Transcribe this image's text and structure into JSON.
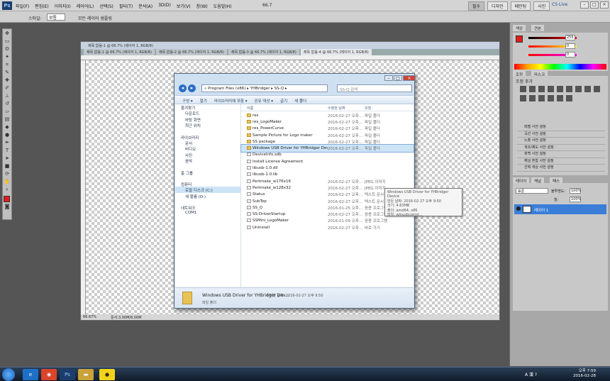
{
  "photoshop": {
    "logo": "Ps",
    "menus": [
      "파일(F)",
      "편집(E)",
      "이미지(I)",
      "레이어(L)",
      "선택(S)",
      "필터(T)",
      "분석(A)",
      "3D(D)",
      "보기(V)",
      "창(W)",
      "도움말(H)"
    ],
    "zoom": "66.7",
    "workspaces": [
      "필수",
      "디자인",
      "페인팅",
      "사진"
    ],
    "cslive": "CS Live",
    "options": {
      "label": "스타일:",
      "value": "보통",
      "label2": "모든 레이어 샘플링"
    }
  },
  "document": {
    "title": "제목 없음-1 @ 66.7% (레이어 1, RGB/8)",
    "tabs": [
      "제목 없음-1 @ 66.7% (레이어 1, RGB/8)",
      "제목 없음-2 @ 66.7% (레이어 1, RGB/8)",
      "제목 없음-3 @ 66.7% (레이어 1, RGB/8)",
      "제목 없음-4 @ 66.7% (레이어 1, RGB/8)"
    ],
    "zoom_status": "66.67%",
    "doc_status": "문서:3.00M/6.00M"
  },
  "explorer": {
    "path": "« Program Files (x86) ▸ YHBridger ▸ SS-Q ▸",
    "search_placeholder": "SS-Q 검색",
    "commands": [
      "구성 ▾",
      "열기",
      "라이브러리에 포함 ▾",
      "공유 대상 ▾",
      "굽기",
      "새 폴더"
    ],
    "nav": [
      {
        "label": "즐겨찾기",
        "sub": false
      },
      {
        "label": "다운로드",
        "sub": true
      },
      {
        "label": "바탕 화면",
        "sub": true
      },
      {
        "label": "최근 위치",
        "sub": true
      },
      {
        "label": "",
        "sub": false
      },
      {
        "label": "라이브러리",
        "sub": false
      },
      {
        "label": "문서",
        "sub": true
      },
      {
        "label": "비디오",
        "sub": true
      },
      {
        "label": "사진",
        "sub": true
      },
      {
        "label": "음악",
        "sub": true
      },
      {
        "label": "",
        "sub": false
      },
      {
        "label": "홈 그룹",
        "sub": false
      },
      {
        "label": "",
        "sub": false
      },
      {
        "label": "컴퓨터",
        "sub": false
      },
      {
        "label": "로컬 디스크 (C:)",
        "sub": true,
        "selected": true
      },
      {
        "label": "새 볼륨 (D:)",
        "sub": true
      },
      {
        "label": "",
        "sub": false
      },
      {
        "label": "네트워크",
        "sub": false
      },
      {
        "label": "COM1",
        "sub": true
      }
    ],
    "columns": [
      "이름",
      "수정한 날짜",
      "유형"
    ],
    "files": [
      {
        "name": "res",
        "date": "2016-02-27 오후...",
        "type": "파일 폴더",
        "icon": "folder-icon"
      },
      {
        "name": "res_LogoMaker",
        "date": "2016-02-27 오후...",
        "type": "파일 폴더",
        "icon": "folder-icon"
      },
      {
        "name": "res_PowerCurve",
        "date": "2016-02-27 오후...",
        "type": "파일 폴더",
        "icon": "folder-icon"
      },
      {
        "name": "Sample Picture for Logo maker",
        "date": "2016-02-27 오후...",
        "type": "파일 폴더",
        "icon": "folder-icon"
      },
      {
        "name": "SS package",
        "date": "2016-02-27 오후...",
        "type": "파일 폴더",
        "icon": "folder-icon"
      },
      {
        "name": "Windows USB Driver for YHBridger Dev...",
        "date": "2016-02-27 오후...",
        "type": "파일 폴더",
        "icon": "folder-icon",
        "selected": true
      },
      {
        "name": "DeviceInfo.sdb",
        "date": "",
        "type": "",
        "icon": "file-icon"
      },
      {
        "name": "Install License Agreement",
        "date": "",
        "type": "",
        "icon": "file-icon"
      },
      {
        "name": "libusb-1.0.dll",
        "date": "",
        "type": "",
        "icon": "file-icon"
      },
      {
        "name": "libusb-1.0.lib",
        "date": "",
        "type": "",
        "icon": "file-icon"
      },
      {
        "name": "Pertmake_w176x16",
        "date": "2016-02-27 오후...",
        "type": "JPEG 이미지",
        "icon": "file-icon"
      },
      {
        "name": "Pertmake_w128x32",
        "date": "2016-02-27 오후...",
        "type": "JPEG 이미지",
        "icon": "file-icon"
      },
      {
        "name": "Status",
        "date": "2016-02-27 오후...",
        "type": "텍스트 문서",
        "icon": "file-icon"
      },
      {
        "name": "SubTop",
        "date": "2016-02-27 오후...",
        "type": "텍스트 문서",
        "icon": "file-icon"
      },
      {
        "name": "SS_Q",
        "date": "2016-01-25 오후...",
        "type": "응용 프로그램",
        "icon": "file-icon"
      },
      {
        "name": "SS-DriverStartup",
        "date": "2016-02-27 오후...",
        "type": "응용 프로그램",
        "icon": "file-icon"
      },
      {
        "name": "SSMini_LogoMaker",
        "date": "2016-01-09 오후...",
        "type": "응용 프로그램",
        "icon": "file-icon"
      },
      {
        "name": "Uninstall",
        "date": "2016-02-27 오후...",
        "type": "바로 가기",
        "icon": "file-icon"
      }
    ],
    "tooltip": [
      "Windows USB Driver for YHBridger Device",
      "만든 날짜: 2016-02-27 오후 9:50",
      "크기: 4.63MB",
      "폴더: amd64, x86",
      "파일: winusbcoinst..."
    ],
    "details": {
      "name": "Windows USB Driver for YHBridger Dev...",
      "meta": "수정한 날짜: 2016-02-27 오후 9:50",
      "type": "파일 폴더"
    }
  },
  "panels": {
    "color_tab": "색상",
    "swatch_tab": "견본",
    "color_values": [
      "255",
      "0",
      "0"
    ],
    "adj_tabs": [
      "조정",
      "마스크"
    ],
    "adj_title": "조정 추가",
    "presets": [
      "레벨 사전 설정",
      "곡선 사전 설정",
      "노출 사전 설정",
      "색조/채도 사전 설정",
      "흑백 사전 설정",
      "채널 혼합 사전 설정",
      "선택 색상 사전 설정"
    ],
    "layers_tabs": [
      "레이어",
      "채널",
      "패스"
    ],
    "blend_mode": "표준",
    "opacity_label": "불투명도:",
    "opacity": "100%",
    "fill_label": "칠:",
    "fill": "100%",
    "layer_name": "레이어 1"
  },
  "taskbar": {
    "tray": "A 漢 ?",
    "time": "오후 7:59",
    "date": "2016-02-28"
  }
}
